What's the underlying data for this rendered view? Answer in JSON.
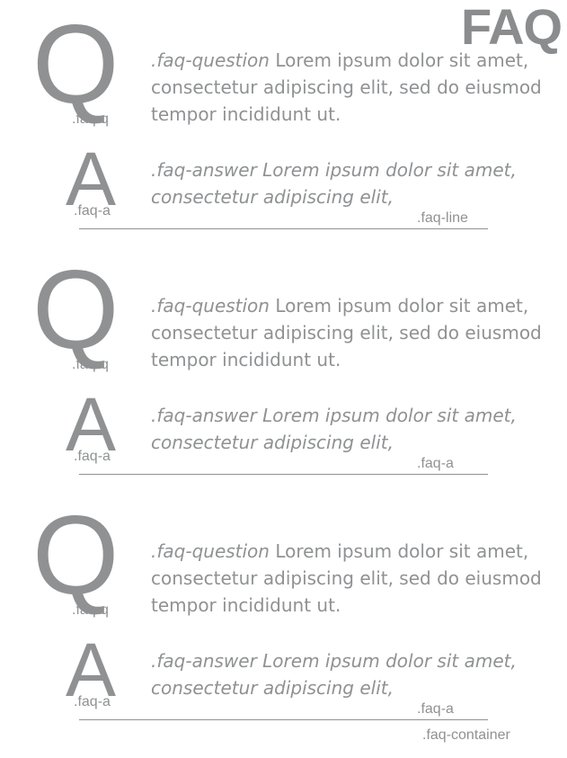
{
  "header": {
    "title": "FAQ"
  },
  "blocks": [
    {
      "q_letter": "Q",
      "a_letter": "A",
      "q_label": ".faq-q",
      "a_label": ".faq-a",
      "question_class": ".faq-question",
      "question_text": " Lorem ipsum dolor sit amet, consectetur adipiscing elit, sed do eiusmod tempor incididunt ut.",
      "answer_text": ".faq-answer Lorem ipsum dolor sit amet, consectetur adipiscing elit,",
      "line_label": ".faq-line"
    },
    {
      "q_letter": "Q",
      "a_letter": "A",
      "q_label": ".faq-q",
      "a_label": ".faq-a",
      "question_class": ".faq-question",
      "question_text": " Lorem ipsum dolor sit amet, consectetur adipiscing elit, sed do eiusmod tempor incididunt ut.",
      "answer_text": ".faq-answer Lorem ipsum dolor sit amet, consectetur adipiscing elit,",
      "line_label": ".faq-a"
    },
    {
      "q_letter": "Q",
      "a_letter": "A",
      "q_label": ".faq-q",
      "a_label": ".faq-a",
      "question_class": ".faq-question",
      "question_text": " Lorem ipsum dolor sit amet, consectetur adipiscing elit, sed do eiusmod tempor incididunt ut.",
      "answer_text": ".faq-answer Lorem ipsum dolor sit amet, consectetur adipiscing elit,",
      "line_label": ".faq-a"
    }
  ],
  "footer": {
    "container_label": ".faq-container"
  }
}
